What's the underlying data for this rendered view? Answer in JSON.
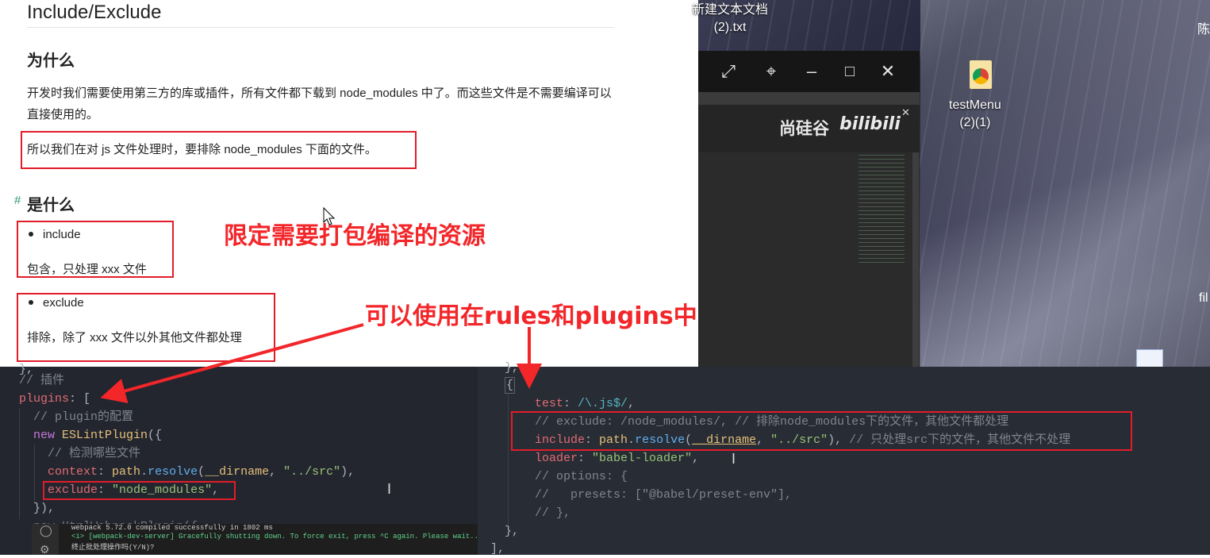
{
  "doc": {
    "title": "Include/Exclude",
    "h_why": "为什么",
    "intro": "开发时我们需要使用第三方的库或插件，所有文件都下载到 node_modules 中了。而这些文件是不需要编译可以直接使用的。",
    "exclude_note": "所以我们在对 js 文件处理时，要排除 node_modules 下面的文件。",
    "h_what": "是什么",
    "anchor": "#",
    "include_label": "include",
    "include_desc": "包含，只处理 xxx 文件",
    "exclude_label": "exclude",
    "exclude_desc": "排除，除了 xxx 文件以外其他文件都处理"
  },
  "annotations": {
    "limit": "限定需要打包编译的资源",
    "usage": "可以使用在rules和plugins中",
    "color": "#e11d2a"
  },
  "desktop": {
    "text_file_label_1": "新建文本文档",
    "text_file_label_2": "(2).txt",
    "test_menu_label_1": "testMenu",
    "test_menu_label_2": "(2)(1)",
    "frag_top": "陈",
    "frag_mid": "fil",
    "icons": [
      "restore-icon",
      "pin-icon",
      "minimize-icon",
      "maximize-icon",
      "close-icon"
    ],
    "bili_cn": "尚硅谷",
    "bili_logo": "bilibili"
  },
  "code_left": {
    "l0": "}, ",
    "l1": "// 插件",
    "l2a": "plugins",
    "l2b": ": [",
    "l3": "  // plugin的配置",
    "l4a": "  new ",
    "l4b": "ESLintPlugin",
    "l4c": "({",
    "l5": "    // 检测哪些文件",
    "l6a": "    context",
    "l6b": ": ",
    "l6c": "path",
    "l6d": ".",
    "l6e": "resolve",
    "l6f": "(",
    "l6g": "__dirname",
    "l6h": ", ",
    "l6i": "\"../src\"",
    "l6j": "),",
    "l7a": "    exclude",
    "l7b": ": ",
    "l7c": "\"node_modules\"",
    "l7d": ",",
    "l8": "  }),",
    "l9": "  new HtmlWebpackPlugin({"
  },
  "code_right": {
    "l0": "},",
    "l1": "{",
    "l2a": "  test",
    "l2b": ": ",
    "l2c": "/\\.js$/",
    "l2d": ",",
    "l3": "  // exclude: /node_modules/, // 排除node_modules下的文件，其他文件都处理",
    "l4a": "  include",
    "l4b": ": ",
    "l4c": "path",
    "l4d": ".",
    "l4e": "resolve",
    "l4f": "(",
    "l4g": "__dirname",
    "l4h": ", ",
    "l4i": "\"../src\"",
    "l4j": "), ",
    "l4k": "// 只处理src下的文件，其他文件不处理",
    "l5a": "  loader",
    "l5b": ": ",
    "l5c": "\"babel-loader\"",
    "l5d": ",",
    "l6": "  // options: {",
    "l7": "  //   presets: [\"@babel/preset-env\"],",
    "l8": "  // },",
    "l9": "},",
    "l10": "],"
  },
  "terminal": {
    "line1": "webpack 5.72.0 compiled successfully in 1802 ms",
    "line2": "<i> [webpack-dev-server] Gracefully shutting down. To force exit, press ^C again. Please wait...",
    "line3": "终止批处理操作吗(Y/N)?"
  }
}
